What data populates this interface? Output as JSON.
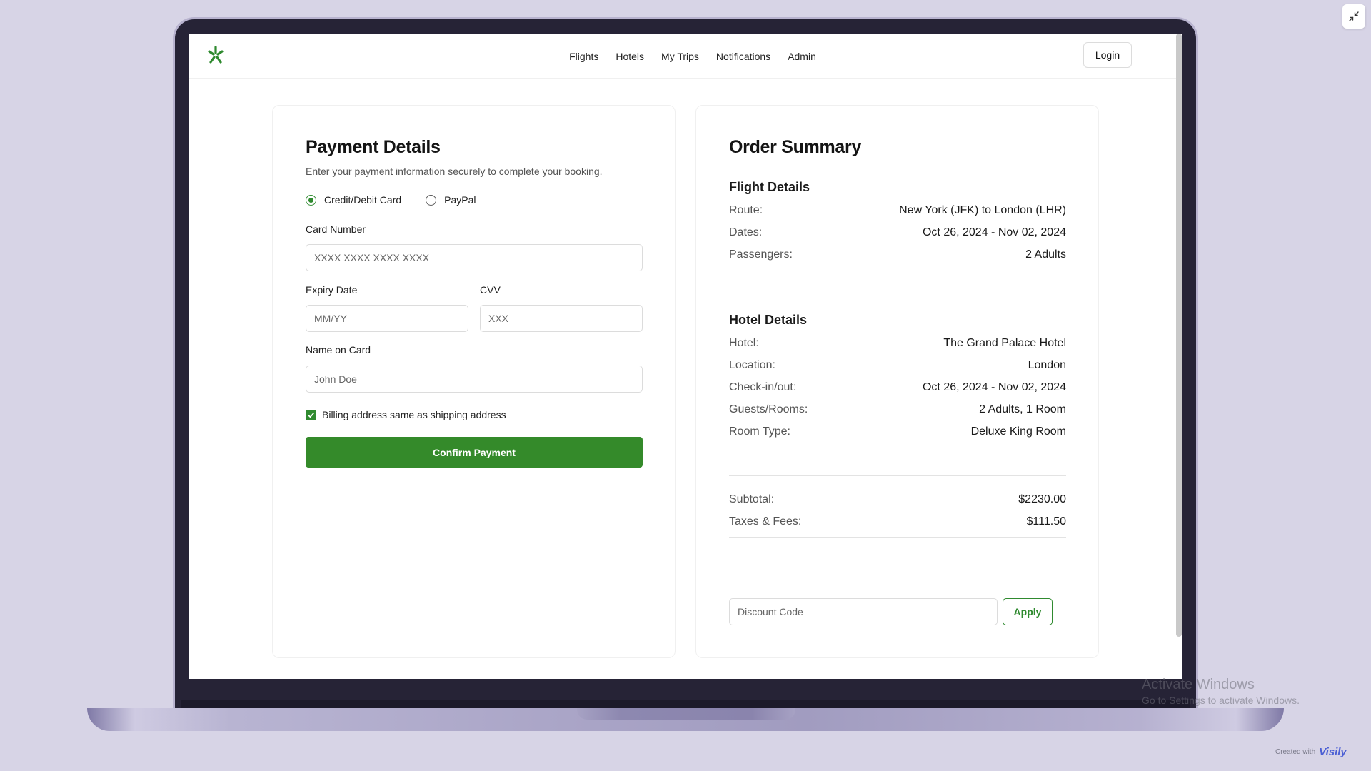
{
  "header": {
    "nav": [
      "Flights",
      "Hotels",
      "My Trips",
      "Notifications",
      "Admin"
    ],
    "login_label": "Login",
    "logo_color": "#2f8a2f"
  },
  "payment": {
    "title": "Payment Details",
    "subtitle": "Enter your payment information securely to complete your booking.",
    "methods": [
      {
        "label": "Credit/Debit Card",
        "selected": true
      },
      {
        "label": "PayPal",
        "selected": false
      }
    ],
    "card_number": {
      "label": "Card Number",
      "placeholder": "XXXX XXXX XXXX XXXX"
    },
    "expiry": {
      "label": "Expiry Date",
      "placeholder": "MM/YY"
    },
    "cvv": {
      "label": "CVV",
      "placeholder": "XXX"
    },
    "name": {
      "label": "Name on Card",
      "placeholder": "John Doe"
    },
    "billing_same": {
      "label": "Billing address same as shipping address",
      "checked": true
    },
    "confirm_label": "Confirm Payment",
    "accent_color": "#348a2a"
  },
  "summary": {
    "title": "Order Summary",
    "flight": {
      "title": "Flight Details",
      "rows": [
        {
          "key": "Route:",
          "value": "New York (JFK) to London (LHR)"
        },
        {
          "key": "Dates:",
          "value": "Oct 26, 2024 - Nov 02, 2024"
        },
        {
          "key": "Passengers:",
          "value": "2 Adults"
        }
      ]
    },
    "hotel": {
      "title": "Hotel Details",
      "rows": [
        {
          "key": "Hotel:",
          "value": "The Grand Palace Hotel"
        },
        {
          "key": "Location:",
          "value": "London"
        },
        {
          "key": "Check-in/out:",
          "value": "Oct 26, 2024 - Nov 02, 2024"
        },
        {
          "key": "Guests/Rooms:",
          "value": "2 Adults, 1 Room"
        },
        {
          "key": "Room Type:",
          "value": "Deluxe King Room"
        }
      ]
    },
    "totals": [
      {
        "key": "Subtotal:",
        "value": "$2230.00"
      },
      {
        "key": "Taxes & Fees:",
        "value": "$111.50"
      }
    ],
    "discount_placeholder": "Discount Code",
    "apply_label": "Apply"
  },
  "overlay": {
    "watermark_title": "Activate Windows",
    "watermark_sub": "Go to Settings to activate Windows.",
    "credit_text": "Created with",
    "credit_brand": "Visily"
  }
}
